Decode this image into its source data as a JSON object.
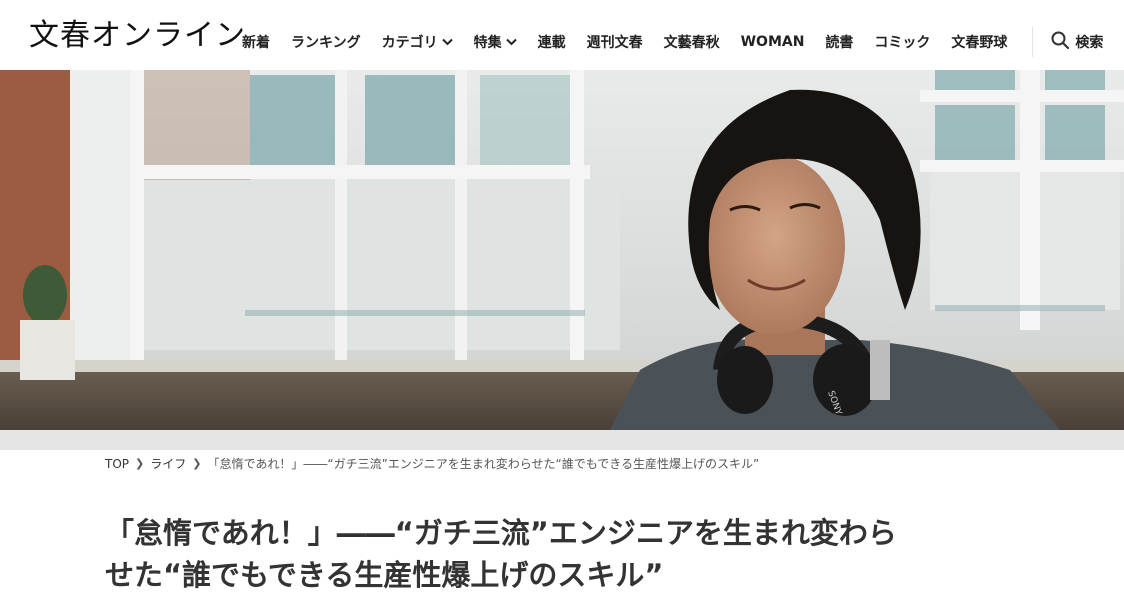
{
  "header": {
    "logo": "文春オンライン",
    "nav": [
      {
        "label": "新着",
        "dropdown": false
      },
      {
        "label": "ランキング",
        "dropdown": false
      },
      {
        "label": "カテゴリ",
        "dropdown": true
      },
      {
        "label": "特集",
        "dropdown": true
      },
      {
        "label": "連載",
        "dropdown": false
      },
      {
        "label": "週刊文春",
        "dropdown": false
      },
      {
        "label": "文藝春秋",
        "dropdown": false
      },
      {
        "label": "WOMAN",
        "dropdown": false
      },
      {
        "label": "読書",
        "dropdown": false
      },
      {
        "label": "コミック",
        "dropdown": false
      },
      {
        "label": "文春野球",
        "dropdown": false
      }
    ],
    "search_label": "検索"
  },
  "breadcrumb": {
    "items": [
      "TOP",
      "ライフ"
    ],
    "current": "「怠惰であれ！」――“ガチ三流”エンジニアを生まれ変わらせた“誰でもできる生産性爆上げのスキル”"
  },
  "article": {
    "title_line1": "「怠惰であれ！」――“ガチ三流”エンジニアを生まれ変わら",
    "title_line2": "せた“誰でもできる生産性爆上げのスキル”"
  },
  "hero": {
    "headphone_brand": "SONY"
  },
  "colors": {
    "text": "#222222",
    "title": "#333333",
    "crumb_bar": "#e5e5e5"
  }
}
